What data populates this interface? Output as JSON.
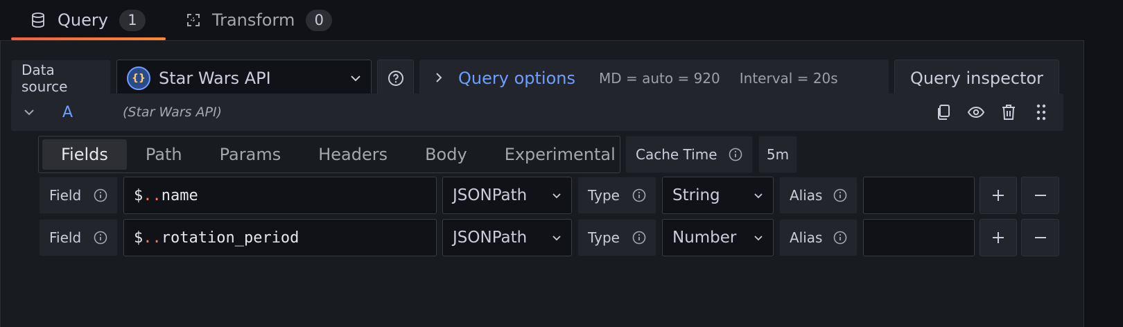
{
  "tabs": [
    {
      "label": "Query",
      "count": "1",
      "icon": "database-icon"
    },
    {
      "label": "Transform",
      "count": "0",
      "icon": "transform-icon"
    }
  ],
  "toolbar": {
    "data_source_label": "Data source",
    "data_source_value": "Star Wars API",
    "query_options_label": "Query options",
    "md_info": "MD = auto = 920",
    "interval_info": "Interval = 20s",
    "query_inspector_label": "Query inspector"
  },
  "query": {
    "ref_id": "A",
    "datasource_name": "(Star Wars API)",
    "subtabs": [
      "Fields",
      "Path",
      "Params",
      "Headers",
      "Body",
      "Experimental"
    ],
    "cache_time_label": "Cache Time",
    "cache_time_value": "5m",
    "fields": [
      {
        "label": "Field",
        "prefix": "$",
        "dots": "..",
        "path": "name",
        "lang": "JSONPath",
        "type_label": "Type",
        "type": "String",
        "alias_label": "Alias",
        "alias": ""
      },
      {
        "label": "Field",
        "prefix": "$",
        "dots": "..",
        "path": "rotation_period",
        "lang": "JSONPath",
        "type_label": "Type",
        "type": "Number",
        "alias_label": "Alias",
        "alias": ""
      }
    ]
  },
  "colors": {
    "accent": "#6e9fff",
    "active_tab_underline": "#f55f3e",
    "path_dots": "#ff7a45"
  }
}
